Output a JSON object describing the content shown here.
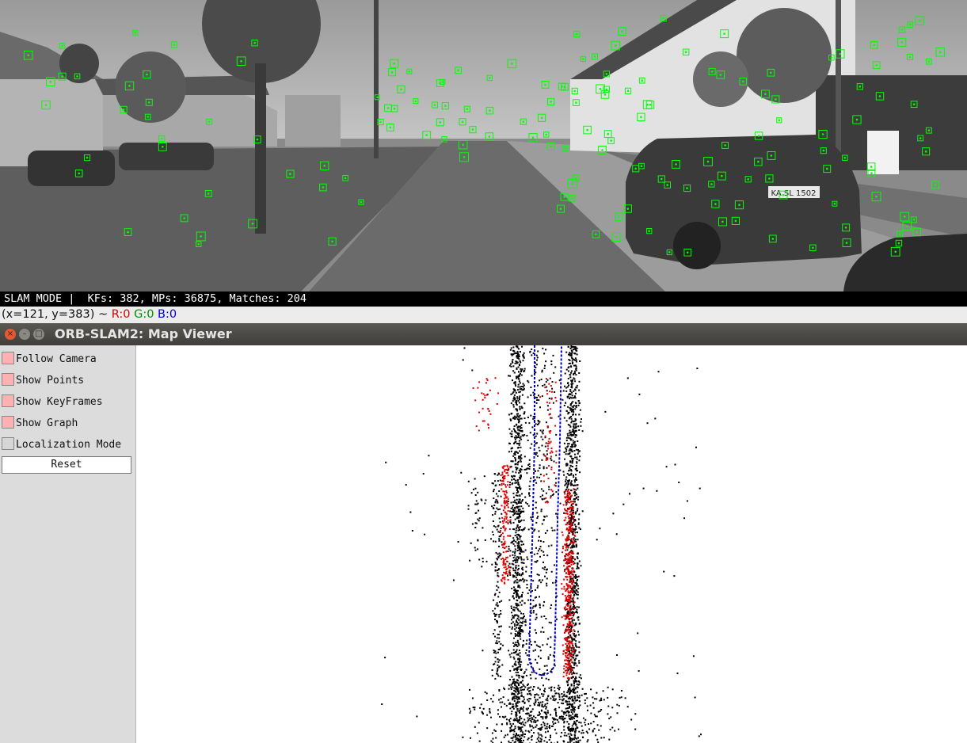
{
  "camera_view": {
    "status_text": "SLAM MODE |  KFs: 382, MPs: 36875, Matches: 204",
    "feature_color": "#00ff00",
    "license_plate": "KA SL 1502"
  },
  "pixel_readout": {
    "coords": "(x=121, y=383) ~ ",
    "r": "R:0",
    "g": "G:0",
    "b": "B:0"
  },
  "window": {
    "title": "ORB-SLAM2: Map Viewer",
    "close_glyph": "×",
    "min_glyph": "–",
    "max_glyph": "□"
  },
  "panel": {
    "items": [
      {
        "label": "Follow Camera",
        "checked": true
      },
      {
        "label": "Show Points",
        "checked": true
      },
      {
        "label": "Show KeyFrames",
        "checked": true
      },
      {
        "label": "Show Graph",
        "checked": true
      },
      {
        "label": "Localization Mode",
        "checked": false
      }
    ],
    "reset_label": "Reset"
  },
  "map_viewer": {
    "map_point_color": "#000000",
    "local_point_color": "#e00000",
    "keyframe_color": "#0000cc",
    "graph_color": "#00aa44"
  },
  "colors": {
    "checkbox_on": "#ffb0b0",
    "titlebar": "#4a4843"
  }
}
